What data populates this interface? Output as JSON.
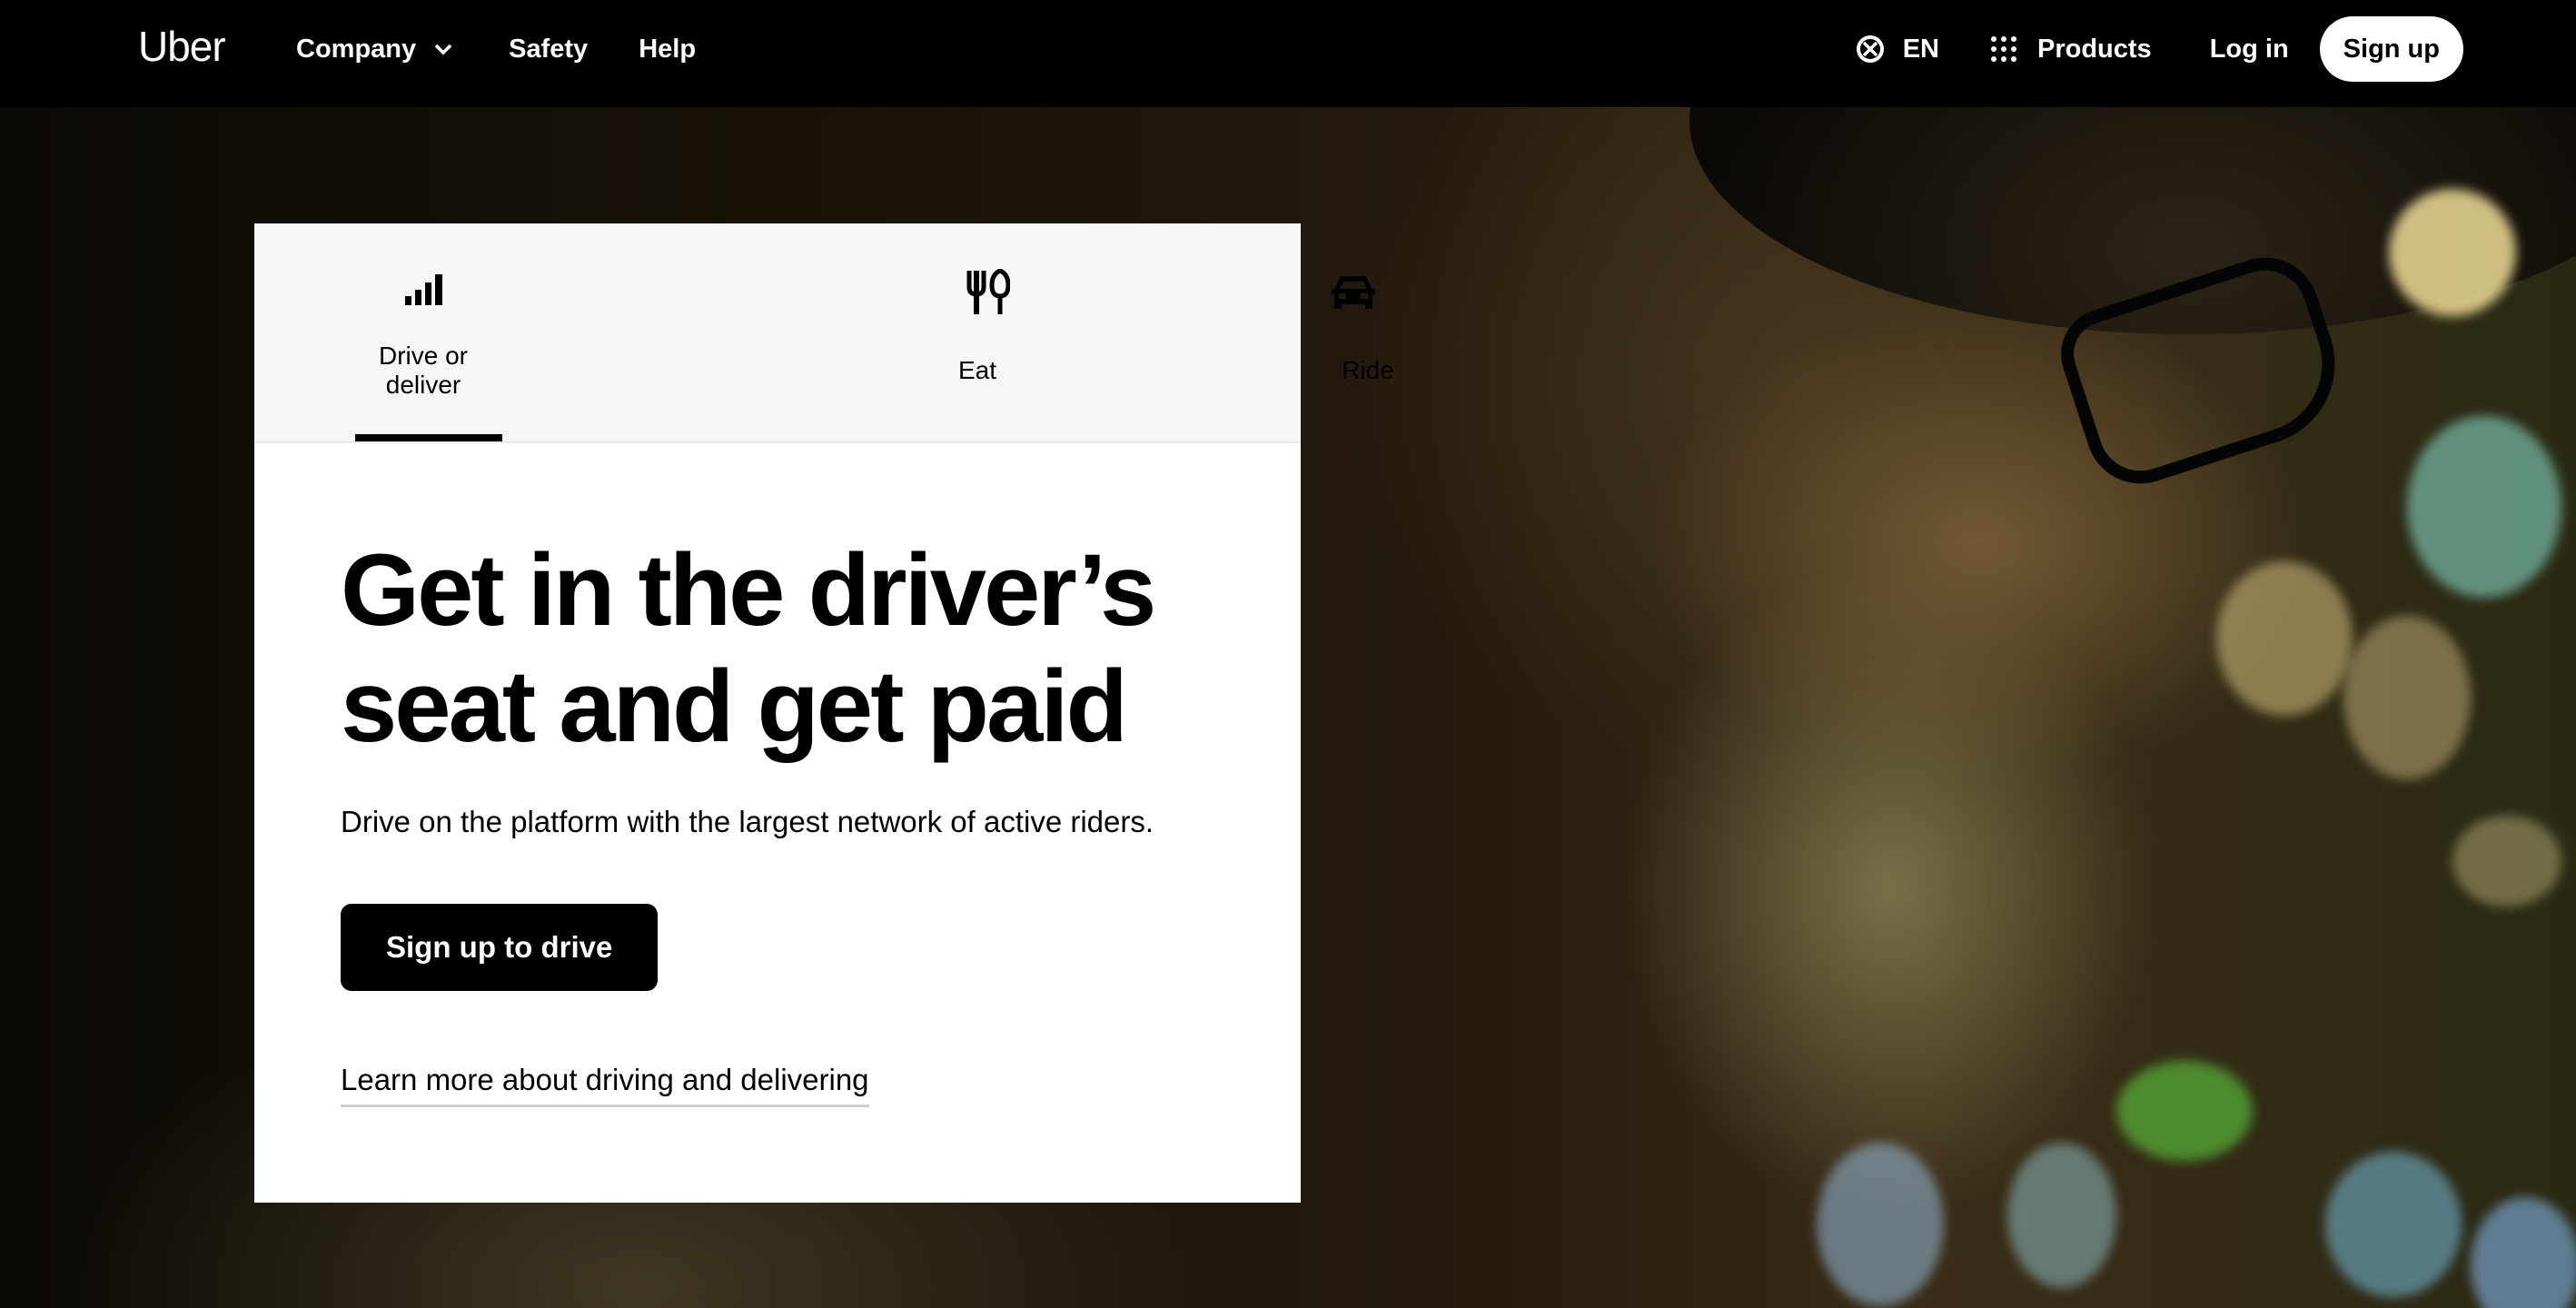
{
  "nav": {
    "logo": "Uber",
    "company": "Company",
    "safety": "Safety",
    "help": "Help",
    "language": "EN",
    "products": "Products",
    "login": "Log in",
    "signup": "Sign up"
  },
  "tabs": [
    {
      "label": "Drive or deliver",
      "icon": "signal-bars-icon",
      "selected": true
    },
    {
      "label": "Eat",
      "icon": "fork-knife-icon",
      "selected": false
    },
    {
      "label": "Ride",
      "icon": "car-icon",
      "selected": false
    }
  ],
  "hero": {
    "headline": "Get in the driver’s seat and get paid",
    "subtext": "Drive on the platform with the largest network of active riders.",
    "cta": "Sign up to drive",
    "learn_more": "Learn more about driving and delivering"
  },
  "colors": {
    "nav_bg": "#000000",
    "card_bg": "#ffffff",
    "tabs_bg": "#f6f6f6",
    "cta_bg": "#000000"
  }
}
